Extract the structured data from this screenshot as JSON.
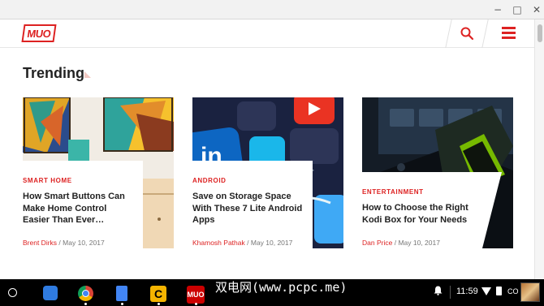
{
  "window": {
    "minimize": "−",
    "maximize": "□",
    "close": "✕"
  },
  "site": {
    "logo_text": "MUO",
    "search_icon": "search-icon",
    "menu_icon": "hamburger-menu-icon",
    "accent_color": "#dd2222"
  },
  "section": {
    "title": "Trending"
  },
  "articles": [
    {
      "category": "SMART HOME",
      "title": "How Smart Buttons Can Make Home Control Easier Than Ever…",
      "author": "Brent Dirks",
      "separator": "/",
      "date": "May 10, 2017"
    },
    {
      "category": "ANDROID",
      "title": "Save on Storage Space With These 7 Lite Android Apps",
      "author": "Khamosh Pathak",
      "separator": "/",
      "date": "May 10, 2017"
    },
    {
      "category": "ENTERTAINMENT",
      "title": "How to Choose the Right Kodi Box for Your Needs",
      "author": "Dan Price",
      "separator": "/",
      "date": "May 10, 2017"
    }
  ],
  "taskbar": {
    "apps": [
      "launcher-icon",
      "files-icon",
      "chrome-icon",
      "docs-icon",
      "c-app-icon",
      "muo-app-icon"
    ],
    "c_app_letter": "C",
    "muo_app_text": "MUO",
    "watermark": "双电网(www.pcpc.me)",
    "time": "11:59",
    "locale": "CO"
  }
}
